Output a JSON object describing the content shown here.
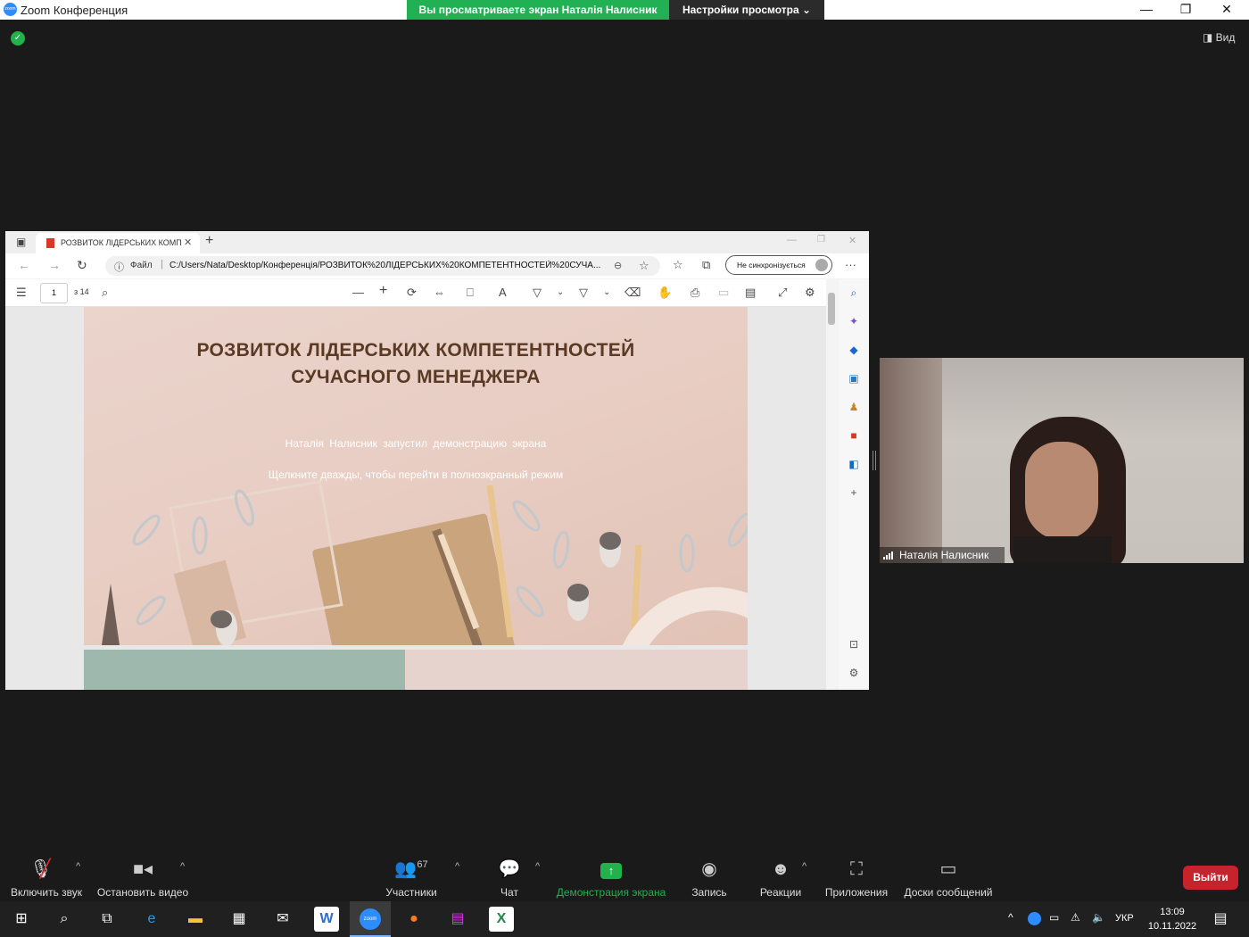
{
  "window": {
    "title": "Zoom Конференция",
    "minimize": "—",
    "maximize": "❐",
    "close": "✕"
  },
  "banner": {
    "viewing_text": "Вы просматриваете экран Наталія Налисник",
    "view_settings": "Настройки просмотра ⌄"
  },
  "view_button": "Вид",
  "browser": {
    "tab_title": "РОЗВИТОК ЛІДЕРСЬКИХ КОМПЕТЕНТНОСТЕЙ",
    "tab_close": "✕",
    "new_tab": "+",
    "file_label": "Файл",
    "url": "C:/Users/Nata/Desktop/Конференція/РОЗВИТОК%20ЛІДЕРСЬКИХ%20КОМПЕТЕНТНОСТЕЙ%20СУЧА...",
    "sync_label": "Не синхронізується",
    "more": "···"
  },
  "pdf": {
    "page_number": "1",
    "page_count": "з 14",
    "slide_title_line1": "РОЗВИТОК ЛІДЕРСЬКИХ КОМПЕТЕНТНОСТЕЙ",
    "slide_title_line2": "СУЧАСНОГО МЕНЕДЖЕРА",
    "overlay_started": "Наталія  Налисник  запустил  демонстрацию  экрана",
    "overlay_fullscreen": "Щелкните дважды, чтобы перейти в полноэкранный режим"
  },
  "participant": {
    "name": "Наталія Налисник"
  },
  "toolbar": {
    "mute": "Включить звук",
    "video": "Остановить видео",
    "participants": "Участники",
    "participants_count": "67",
    "chat": "Чат",
    "share": "Демонстрация экрана",
    "record": "Запись",
    "reactions": "Реакции",
    "apps": "Приложения",
    "whiteboards": "Доски сообщений",
    "leave": "Выйти"
  },
  "taskbar": {
    "zoom_label": "zoom",
    "language": "УКР",
    "time": "13:09",
    "date": "10.11.2022"
  },
  "colors": {
    "zoom_green": "#23b14d",
    "leave_red": "#c6232c",
    "slide_title": "#5a3a24"
  }
}
